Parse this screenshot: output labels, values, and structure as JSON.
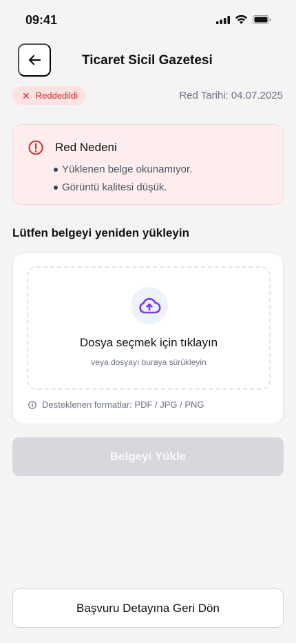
{
  "status_bar": {
    "time": "09:41"
  },
  "header": {
    "title": "Ticaret Sicil Gazetesi"
  },
  "status": {
    "badge_label": "Reddedildi",
    "reject_date": "Red Tarihi: 04.07.2025",
    "badge_color": "#dc2626"
  },
  "reason": {
    "title": "Red Nedeni",
    "items": [
      "Yüklenen belge okunamıyor.",
      "Görüntü kalitesi düşük."
    ]
  },
  "upload": {
    "section_title": "Lütfen belgeyi yeniden yükleyin",
    "dropzone_title": "Dosya seçmek için tıklayın",
    "dropzone_hint": "veya dosyayı buraya sürükleyin",
    "formats": "Desteklenen formatlar: PDF / JPG / PNG",
    "accent_color": "#7c3aed"
  },
  "buttons": {
    "upload_label": "Belgeyi Yükle",
    "back_detail_label": "Başvuru Detayına Geri Dön"
  }
}
